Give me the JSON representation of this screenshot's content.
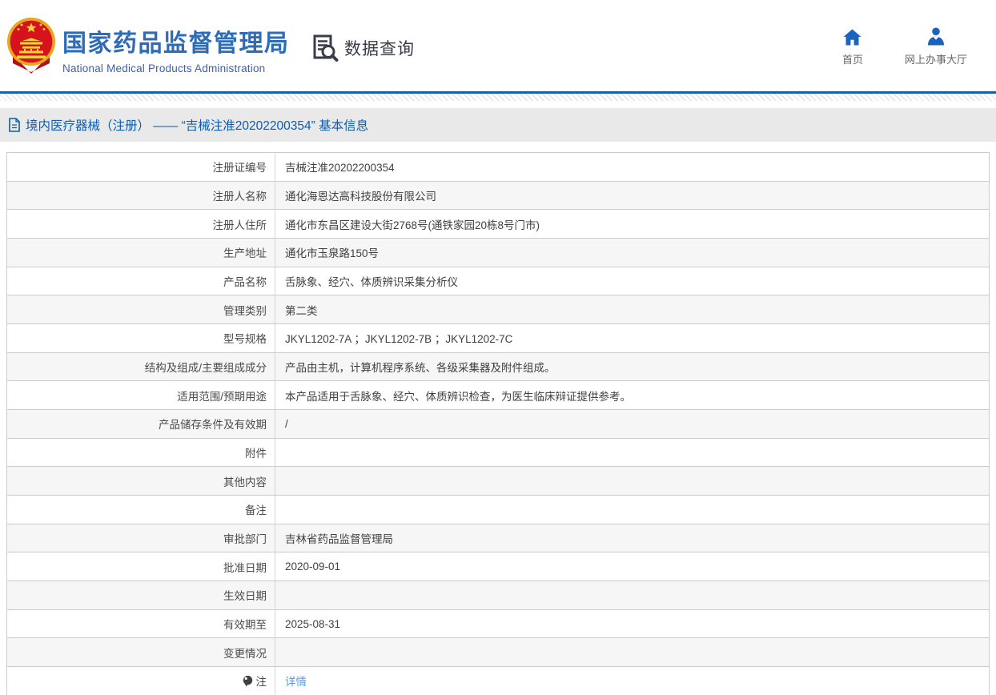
{
  "brand": {
    "emblem_icon": "china-national-emblem",
    "name_cn": "国家药品监督管理局",
    "name_en": "National Medical Products Administration"
  },
  "header": {
    "query_icon": "document-search-icon",
    "query_label": "数据查询",
    "nav": [
      {
        "icon": "home-icon",
        "label": "首页"
      },
      {
        "icon": "user-icon",
        "label": "网上办事大厅"
      }
    ]
  },
  "page": {
    "doc_icon": "document-icon",
    "title": "境内医疗器械（注册） —— “吉械注准20202200354” 基本信息"
  },
  "table": {
    "rows": [
      {
        "label": "注册证编号",
        "value": "吉械注准20202200354"
      },
      {
        "label": "注册人名称",
        "value": "通化海恩达高科技股份有限公司"
      },
      {
        "label": "注册人住所",
        "value": "通化市东昌区建设大街2768号(通铁家园20栋8号门市)"
      },
      {
        "label": "生产地址",
        "value": "通化市玉泉路150号"
      },
      {
        "label": "产品名称",
        "value": "舌脉象、经穴、体质辨识采集分析仪"
      },
      {
        "label": "管理类别",
        "value": "第二类"
      },
      {
        "label": "型号规格",
        "value": "JKYL1202-7A ；JKYL1202-7B ；JKYL1202-7C"
      },
      {
        "label": "结构及组成/主要组成成分",
        "value": "产品由主机，计算机程序系统、各级采集器及附件组成。"
      },
      {
        "label": "适用范围/预期用途",
        "value": "本产品适用于舌脉象、经穴、体质辨识检查，为医生临床辩证提供参考。"
      },
      {
        "label": "产品储存条件及有效期",
        "value": "/"
      },
      {
        "label": "附件",
        "value": ""
      },
      {
        "label": "其他内容",
        "value": ""
      },
      {
        "label": "备注",
        "value": ""
      },
      {
        "label": "审批部门",
        "value": "吉林省药品监督管理局"
      },
      {
        "label": "批准日期",
        "value": "2020-09-01"
      },
      {
        "label": "生效日期",
        "value": ""
      },
      {
        "label": "有效期至",
        "value": "2025-08-31"
      },
      {
        "label": "变更情况",
        "value": ""
      },
      {
        "label": "注",
        "label_icon": "note-balloon-icon",
        "value": "详情",
        "value_is_link": true
      }
    ]
  },
  "colors": {
    "brand_blue": "#2e6cb7",
    "title_blue": "#0d5cb1",
    "link_blue": "#4f9ef0",
    "nav_icon_blue": "#1b63c0",
    "divider_blue": "#1660b2",
    "titlebar_bg": "#e9e9e9",
    "row_alt_bg": "#f6f6f6",
    "border_gray": "#cccccc"
  }
}
